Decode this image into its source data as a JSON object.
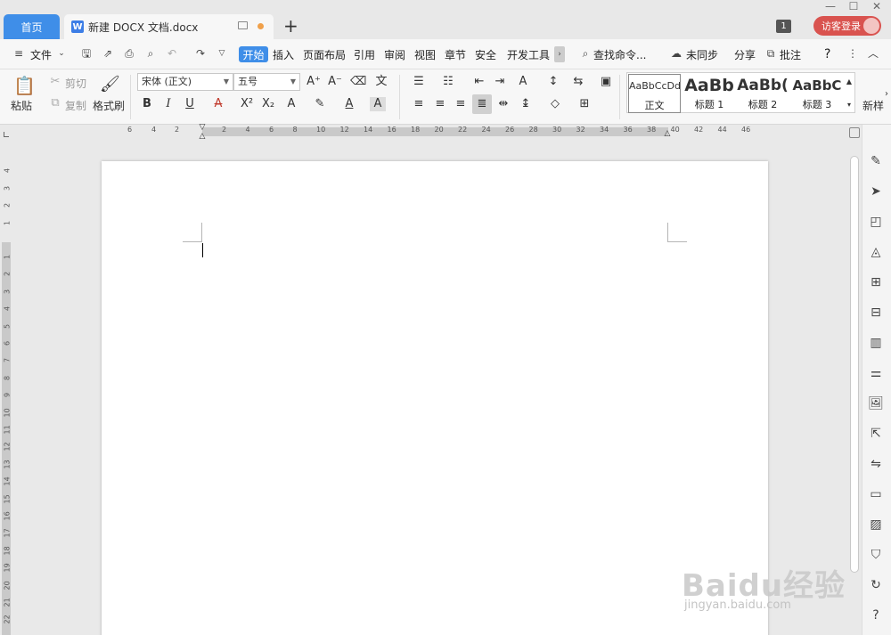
{
  "tabs": {
    "home": "首页",
    "doc_icon": "W",
    "doc_title": "新建 DOCX 文档.docx",
    "new_tab": "+"
  },
  "window": {
    "minimize": "—",
    "maximize": "☐",
    "close": "✕",
    "badge": "1",
    "guest_login": "访客登录"
  },
  "menu": {
    "file": "文件",
    "tabs": [
      "开始",
      "插入",
      "页面布局",
      "引用",
      "审阅",
      "视图",
      "章节",
      "安全",
      "开发工具"
    ],
    "search": "查找命令...",
    "sync": "未同步",
    "share": "分享",
    "comment": "批注",
    "help": "?"
  },
  "ribbon": {
    "paste": "粘贴",
    "cut": "剪切",
    "copy": "复制",
    "format_painter": "格式刷",
    "font_name": "宋体 (正文)",
    "font_size": "五号",
    "styles": [
      {
        "sample": "AaBbCcDd",
        "name": "正文"
      },
      {
        "sample": "AaBb",
        "name": "标题 1"
      },
      {
        "sample": "AaBb(",
        "name": "标题 2"
      },
      {
        "sample": "AaBbC",
        "name": "标题 3"
      }
    ],
    "new_style": "新样"
  },
  "ruler": {
    "top": [
      "6",
      "4",
      "2",
      "2",
      "4",
      "6",
      "8",
      "10",
      "12",
      "14",
      "16",
      "18",
      "20",
      "22",
      "24",
      "26",
      "28",
      "30",
      "32",
      "34",
      "36",
      "38",
      "40",
      "42",
      "44",
      "46"
    ],
    "left": [
      "4",
      "3",
      "2",
      "1",
      "1",
      "2",
      "3",
      "4",
      "5",
      "6",
      "7",
      "8",
      "9",
      "10",
      "11",
      "12",
      "13",
      "14",
      "15",
      "16",
      "17",
      "18",
      "19",
      "20",
      "21",
      "22"
    ]
  },
  "watermark": {
    "main": "Baidu经验",
    "sub": "jingyan.baidu.com"
  }
}
